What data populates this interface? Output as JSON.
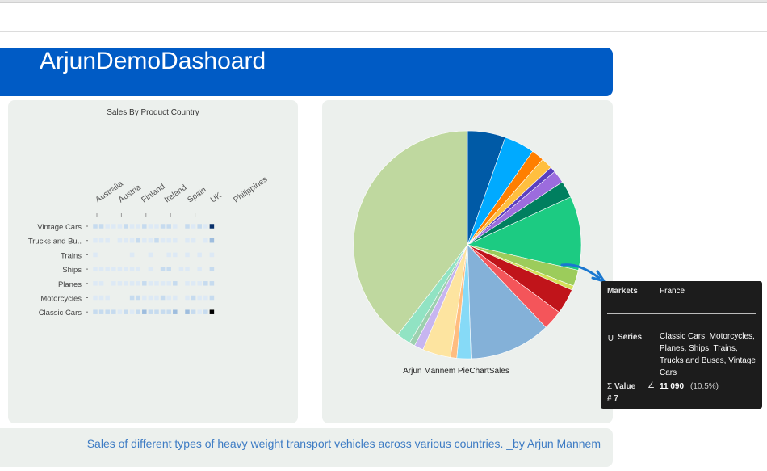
{
  "dashboard": {
    "title": "ArjunDemoDashoard",
    "footer_text": "Sales of different types of heavy weight transport vehicles across various countries. _by Arjun Mannem"
  },
  "heatmap": {
    "title": "Sales By Product Country",
    "x_labels": [
      "Australia",
      "Austria",
      "Finland",
      "Ireland",
      "Spain",
      "UK",
      "Philippines"
    ],
    "rows": [
      "Vintage Cars",
      "Trucks and Bu..",
      "Trains",
      "Ships",
      "Planes",
      "Motorcycles",
      "Classic Cars"
    ],
    "colors": [
      "#ffffff",
      "#dde9f5",
      "#c6dbef",
      "#9ebdde",
      "#6a95c4",
      "#2f5f98",
      "#08306b"
    ],
    "levels": [
      [
        2,
        2,
        1,
        1,
        1,
        2,
        1,
        1,
        2,
        1,
        1,
        2,
        2,
        1,
        0,
        2,
        1,
        2,
        1,
        6
      ],
      [
        1,
        1,
        1,
        0,
        1,
        1,
        1,
        2,
        1,
        1,
        2,
        1,
        1,
        1,
        0,
        1,
        1,
        0,
        1,
        3
      ],
      [
        1,
        0,
        0,
        0,
        0,
        0,
        1,
        0,
        0,
        1,
        0,
        0,
        1,
        1,
        0,
        1,
        0,
        1,
        0,
        1
      ],
      [
        1,
        1,
        1,
        1,
        1,
        1,
        1,
        1,
        0,
        1,
        0,
        2,
        2,
        0,
        1,
        1,
        0,
        1,
        0,
        2
      ],
      [
        1,
        1,
        0,
        1,
        1,
        1,
        1,
        1,
        2,
        1,
        1,
        1,
        1,
        2,
        0,
        1,
        1,
        1,
        2,
        2
      ],
      [
        1,
        1,
        1,
        0,
        0,
        0,
        2,
        2,
        1,
        1,
        1,
        2,
        1,
        1,
        0,
        1,
        2,
        1,
        1,
        2
      ],
      [
        2,
        2,
        2,
        2,
        1,
        2,
        1,
        2,
        3,
        2,
        2,
        2,
        2,
        3,
        0,
        3,
        2,
        1,
        2,
        7
      ]
    ]
  },
  "chart_data": {
    "type": "pie",
    "title": "Arjun Mannem PieChartSales",
    "series_name": "Classic Cars, Motorcycles, Planes, Ships, Trains, Trucks and Buses, Vintage Cars",
    "slices": [
      {
        "value": 5.4,
        "color": "#005aa6"
      },
      {
        "value": 4.3,
        "color": "#00aaff"
      },
      {
        "value": 1.8,
        "color": "#ff7f00"
      },
      {
        "value": 1.6,
        "color": "#ffbf3f"
      },
      {
        "value": 0.8,
        "color": "#5b3fbf"
      },
      {
        "value": 1.8,
        "color": "#9c6cdd"
      },
      {
        "value": 2.4,
        "color": "#007f5f"
      },
      {
        "value": 10.5,
        "color": "#1ccb82"
      },
      {
        "value": 2.3,
        "color": "#9ccc5b"
      },
      {
        "value": 0.6,
        "color": "#d4e157"
      },
      {
        "value": 3.6,
        "color": "#c0141a"
      },
      {
        "value": 2.8,
        "color": "#f4555a"
      },
      {
        "value": 11.6,
        "color": "#84b1d8"
      },
      {
        "value": 2.0,
        "color": "#86daf7"
      },
      {
        "value": 0.9,
        "color": "#ffbd80"
      },
      {
        "value": 4.0,
        "color": "#fde4a0"
      },
      {
        "value": 1.3,
        "color": "#c7b5f0"
      },
      {
        "value": 0.8,
        "color": "#9dd0af"
      },
      {
        "value": 2.0,
        "color": "#91e3c3"
      },
      {
        "value": 39.5,
        "color": "#bfd89f"
      }
    ],
    "tooltip": {
      "markets_label": "Markets",
      "markets_value": "France",
      "series_label": "Series",
      "series_icon": "∪",
      "value_label": "Value",
      "value_icon": "Σ",
      "angle_icon": "∠",
      "value": "11 090",
      "percent": "(10.5%)",
      "index_label": "# 7"
    }
  }
}
